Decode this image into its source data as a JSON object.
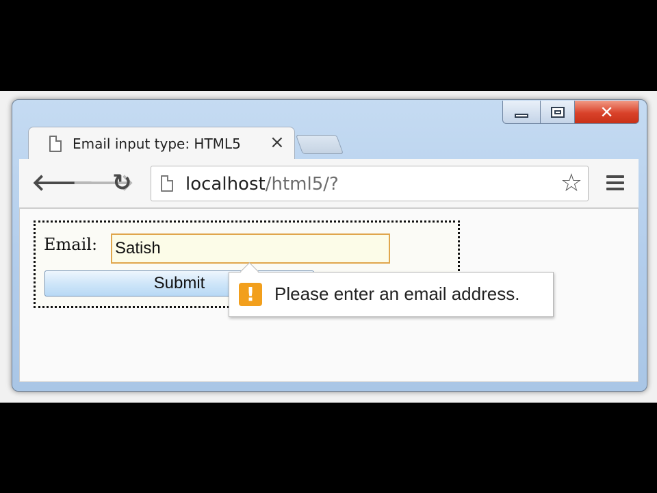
{
  "tab": {
    "title": "Email input type: HTML5",
    "close_glyph": "×"
  },
  "window_controls": {
    "close_glyph": "✕"
  },
  "nav": {
    "back_glyph": "🡐",
    "forward_glyph": "🡒",
    "reload_glyph": "↻"
  },
  "address_bar": {
    "host": "localhost",
    "path": "/html5/?",
    "star_glyph": "☆"
  },
  "form": {
    "email_label": "Email:",
    "email_value": "Satish",
    "submit_label": "Submit"
  },
  "validation": {
    "icon_glyph": "!",
    "message": "Please enter an email address."
  },
  "colors": {
    "warning": "#f29f1c",
    "input_border": "#e0a64c",
    "close_button": "#d9422a"
  }
}
